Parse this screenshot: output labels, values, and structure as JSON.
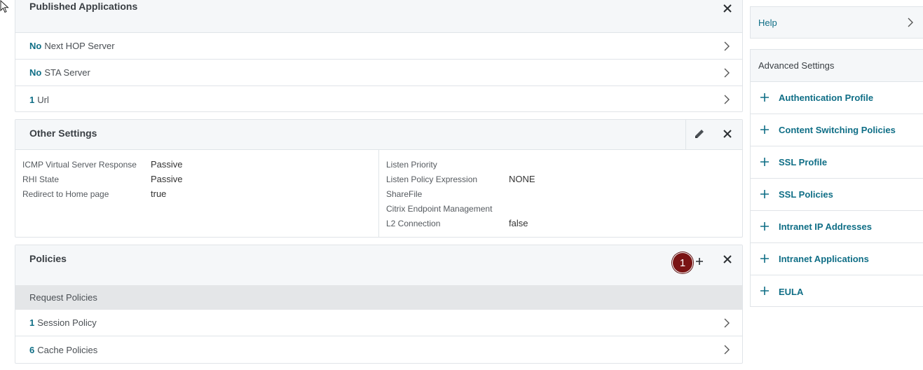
{
  "published_apps": {
    "title": "Published Applications",
    "rows": [
      {
        "count": "No",
        "label": "Next HOP Server"
      },
      {
        "count": "No",
        "label": "STA Server"
      },
      {
        "count": "1",
        "label": "Url"
      }
    ]
  },
  "other_settings": {
    "title": "Other Settings",
    "left": [
      {
        "key": "ICMP Virtual Server Response",
        "value": "Passive"
      },
      {
        "key": "RHI State",
        "value": "Passive"
      },
      {
        "key": "Redirect to Home page",
        "value": "true"
      }
    ],
    "right": [
      {
        "key": "Listen Priority",
        "value": ""
      },
      {
        "key": "Listen Policy Expression",
        "value": "NONE"
      },
      {
        "key": "ShareFile",
        "value": ""
      },
      {
        "key": "Citrix Endpoint Management",
        "value": ""
      },
      {
        "key": "L2 Connection",
        "value": "false"
      }
    ]
  },
  "policies": {
    "title": "Policies",
    "badge": "1",
    "subheader": "Request Policies",
    "rows": [
      {
        "count": "1",
        "label": "Session Policy"
      },
      {
        "count": "6",
        "label": "Cache Policies"
      }
    ]
  },
  "help": {
    "label": "Help"
  },
  "advanced": {
    "title": "Advanced Settings",
    "items": [
      "Authentication Profile",
      "Content Switching Policies",
      "SSL Profile",
      "SSL Policies",
      "Intranet IP Addresses",
      "Intranet Applications",
      "EULA"
    ]
  },
  "colors": {
    "accent": "#0f6e86",
    "badge": "#7a1414",
    "header_bg": "#f5f7f9",
    "subheader_bg": "#e4e6e8"
  }
}
